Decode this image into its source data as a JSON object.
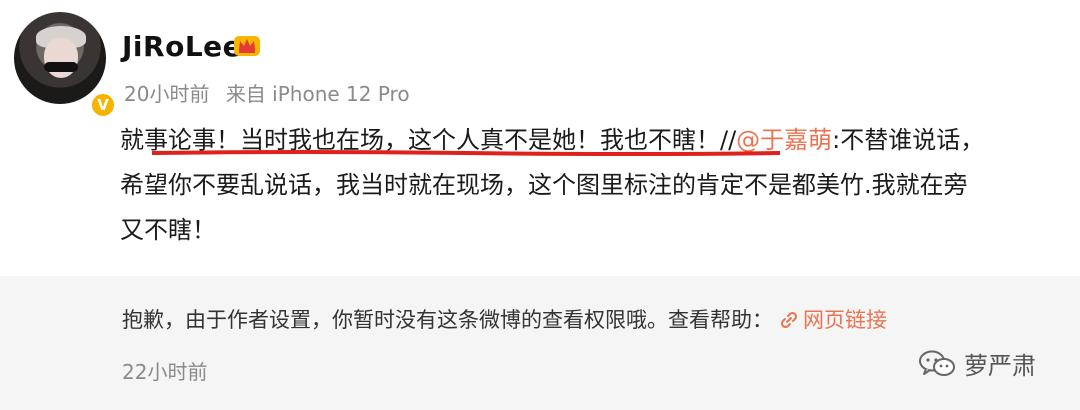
{
  "post": {
    "username": "JiRoLee",
    "time": "20小时前",
    "source": "来自 iPhone 12 Pro",
    "content_line1_main": "就事论事！当时我也在场，这个人真不是她！我也不瞎！//",
    "mention": "@于嘉萌",
    "content_line1_tail": ":不替谁说话，",
    "content_line2": "希望你不要乱说话，我当时就在现场，这个图里标注的肯定不是都美竹.我就在旁",
    "content_line3": "又不瞎！"
  },
  "notice": {
    "text": "抱歉，由于作者设置，你暂时没有这条微博的查看权限哦。查看帮助：",
    "link_label": "网页链接",
    "time": "22小时前"
  },
  "watermark": {
    "text": "萝严肃"
  },
  "colors": {
    "accent": "#eb7350",
    "underline": "#e0201b",
    "badge": "#f6b300"
  }
}
